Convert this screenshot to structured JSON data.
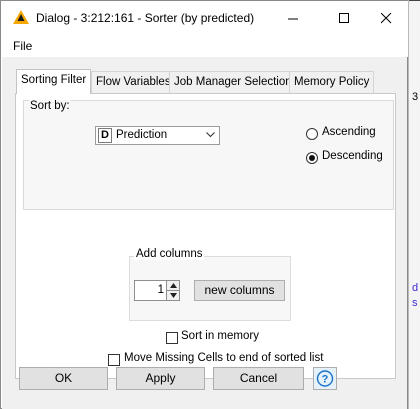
{
  "window": {
    "title": "Dialog - 3:212:161 - Sorter (by predicted)"
  },
  "menu": {
    "file": "File"
  },
  "tabs": [
    {
      "label": "Sorting Filter",
      "active": true
    },
    {
      "label": "Flow Variables",
      "active": false
    },
    {
      "label": "Job Manager Selection",
      "active": false
    },
    {
      "label": "Memory Policy",
      "active": false
    }
  ],
  "sort_by": {
    "title": "Sort by:",
    "column_type_badge": "D",
    "column": "Prediction",
    "order_options": [
      {
        "label": "Ascending",
        "selected": false
      },
      {
        "label": "Descending",
        "selected": true
      }
    ]
  },
  "add_columns": {
    "title": "Add columns",
    "count": "1",
    "new_columns_label": "new columns"
  },
  "options": {
    "sort_in_memory": {
      "label": "Sort in memory",
      "checked": false
    },
    "move_missing": {
      "label": "Move Missing Cells to end of sorted list",
      "checked": false
    }
  },
  "buttons": {
    "ok": "OK",
    "apply": "Apply",
    "cancel": "Cancel"
  },
  "background": {
    "chars": [
      "3",
      "d",
      "s"
    ]
  },
  "colors": {
    "accent": "#f5a800",
    "link": "#3b2bd6",
    "help_icon": "#1a73c9"
  }
}
